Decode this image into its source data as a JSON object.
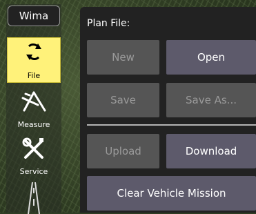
{
  "toolbar": {
    "title": "Wima",
    "items": [
      {
        "label": "File",
        "icon": "sync-arrows-icon",
        "active": true
      },
      {
        "label": "Measure",
        "icon": "measure-tools-icon",
        "active": false
      },
      {
        "label": "Service",
        "icon": "wrench-screwdriver-icon",
        "active": false
      },
      {
        "label": "",
        "icon": "road-icon",
        "active": false
      }
    ]
  },
  "panel": {
    "heading": "Plan File:",
    "buttons": {
      "new": "New",
      "open": "Open",
      "save": "Save",
      "save_as": "Save As...",
      "upload": "Upload",
      "download": "Download",
      "clear": "Clear Vehicle Mission"
    }
  },
  "colors": {
    "active_tool": "#fff27a",
    "panel_bg": "#222222",
    "button_disabled": "#555555",
    "button_enabled": "#5d5a6b"
  }
}
